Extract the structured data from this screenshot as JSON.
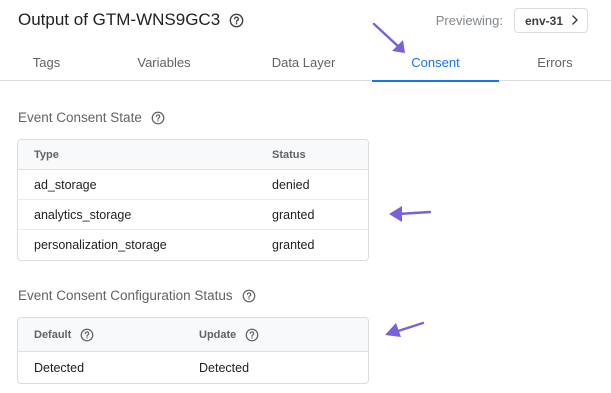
{
  "header": {
    "title": "Output of GTM-WNS9GC3",
    "previewing_label": "Previewing:",
    "env_label": "env-31"
  },
  "tabs": [
    {
      "label": "Tags"
    },
    {
      "label": "Variables"
    },
    {
      "label": "Data Layer"
    },
    {
      "label": "Consent",
      "active": true
    },
    {
      "label": "Errors"
    }
  ],
  "consent_state": {
    "heading": "Event Consent State",
    "columns": [
      "Type",
      "Status"
    ],
    "rows": [
      {
        "type": "ad_storage",
        "status": "denied"
      },
      {
        "type": "analytics_storage",
        "status": "granted"
      },
      {
        "type": "personalization_storage",
        "status": "granted"
      }
    ]
  },
  "config_status": {
    "heading": "Event Consent Configuration Status",
    "columns": [
      "Default",
      "Update"
    ],
    "rows": [
      {
        "default": "Detected",
        "update": "Detected"
      }
    ]
  },
  "colors": {
    "accent": "#1a73e8",
    "annotation_arrow": "#7b61d9"
  },
  "icons": [
    "help-circle-icon",
    "chevron-right-icon",
    "annotation-arrow-icon"
  ]
}
